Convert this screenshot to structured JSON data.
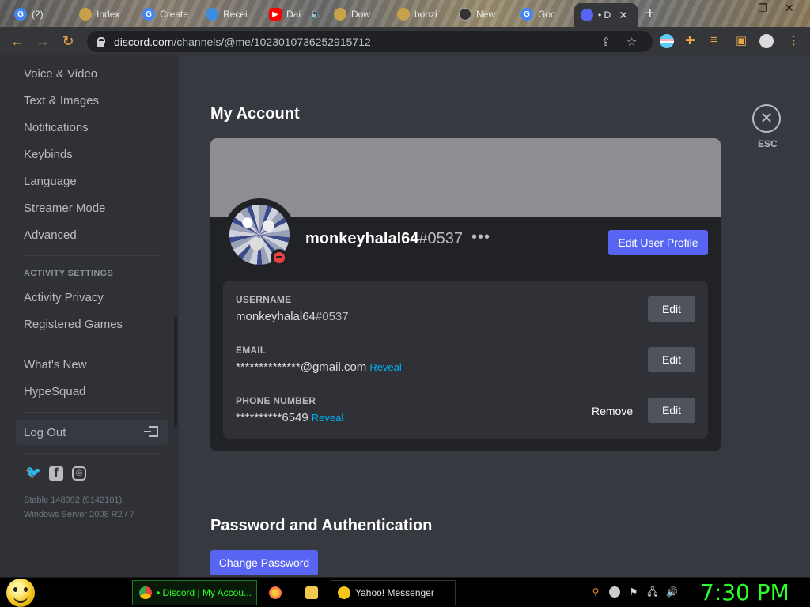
{
  "browser": {
    "tabs": [
      {
        "label": "(2)",
        "color": "#4285f4",
        "glyph": "G"
      },
      {
        "label": "Index",
        "color": "#c8a24a",
        "glyph": ""
      },
      {
        "label": "Create",
        "color": "#4285f4",
        "glyph": "G"
      },
      {
        "label": "Recei",
        "color": "#3d8de0",
        "glyph": ""
      },
      {
        "label": "Dai",
        "color": "#ff0000",
        "glyph": "▶"
      },
      {
        "label": "Dow",
        "color": "#c8a24a",
        "glyph": ""
      },
      {
        "label": "bonzi",
        "color": "#c8a24a",
        "glyph": ""
      },
      {
        "label": "New",
        "color": "#aaaaaa",
        "glyph": ""
      },
      {
        "label": "Goo",
        "color": "#4285f4",
        "glyph": "G"
      }
    ],
    "active_tab": {
      "label": "• D",
      "color": "#5865f2"
    },
    "new_tab_label": "+",
    "address": {
      "host": "discord.com",
      "path": "/channels/@me/1023010736252915712"
    },
    "window_controls": [
      "—",
      "❐",
      "✕"
    ]
  },
  "sidebar": {
    "items_top": [
      {
        "label": "Voice & Video"
      },
      {
        "label": "Text & Images"
      },
      {
        "label": "Notifications"
      },
      {
        "label": "Keybinds"
      },
      {
        "label": "Language"
      },
      {
        "label": "Streamer Mode"
      },
      {
        "label": "Advanced"
      }
    ],
    "activity_header": "ACTIVITY SETTINGS",
    "items_activity": [
      {
        "label": "Activity Privacy"
      },
      {
        "label": "Registered Games"
      }
    ],
    "items_bottom": [
      {
        "label": "What's New"
      },
      {
        "label": "HypeSquad"
      }
    ],
    "logout_label": "Log Out",
    "version_line1": "Stable 148992 (9142101)",
    "version_line2": "Windows Server 2008 R2 / 7"
  },
  "account": {
    "title": "My Account",
    "esc_label": "ESC",
    "username": "monkeyhalal64",
    "discriminator": "#0537",
    "edit_profile_label": "Edit User Profile",
    "fields": {
      "username_label": "USERNAME",
      "username_name": "monkeyhalal64",
      "username_disc": "#0537",
      "email_label": "EMAIL",
      "email_value": "**************@gmail.com",
      "phone_label": "PHONE NUMBER",
      "phone_value": "**********6549",
      "reveal_label": "Reveal",
      "edit_label": "Edit",
      "remove_label": "Remove"
    },
    "password_section_title": "Password and Authentication",
    "change_password_label": "Change Password"
  },
  "taskbar": {
    "tasks": [
      {
        "label": "• Discord | My Accou...",
        "color": "#4285f4",
        "active": true
      },
      {
        "label": "",
        "color": "#ff7139",
        "active": false
      },
      {
        "label": "",
        "color": "#f2c94c",
        "active": false
      },
      {
        "label": "Yahoo! Messenger",
        "color": "#f6c61e",
        "active": false
      }
    ],
    "clock": "7:30 PM"
  },
  "colors": {
    "blurple": "#5865f2",
    "link": "#00aff4",
    "dnd": "#ed4245",
    "clock_green": "#2cff2c"
  }
}
